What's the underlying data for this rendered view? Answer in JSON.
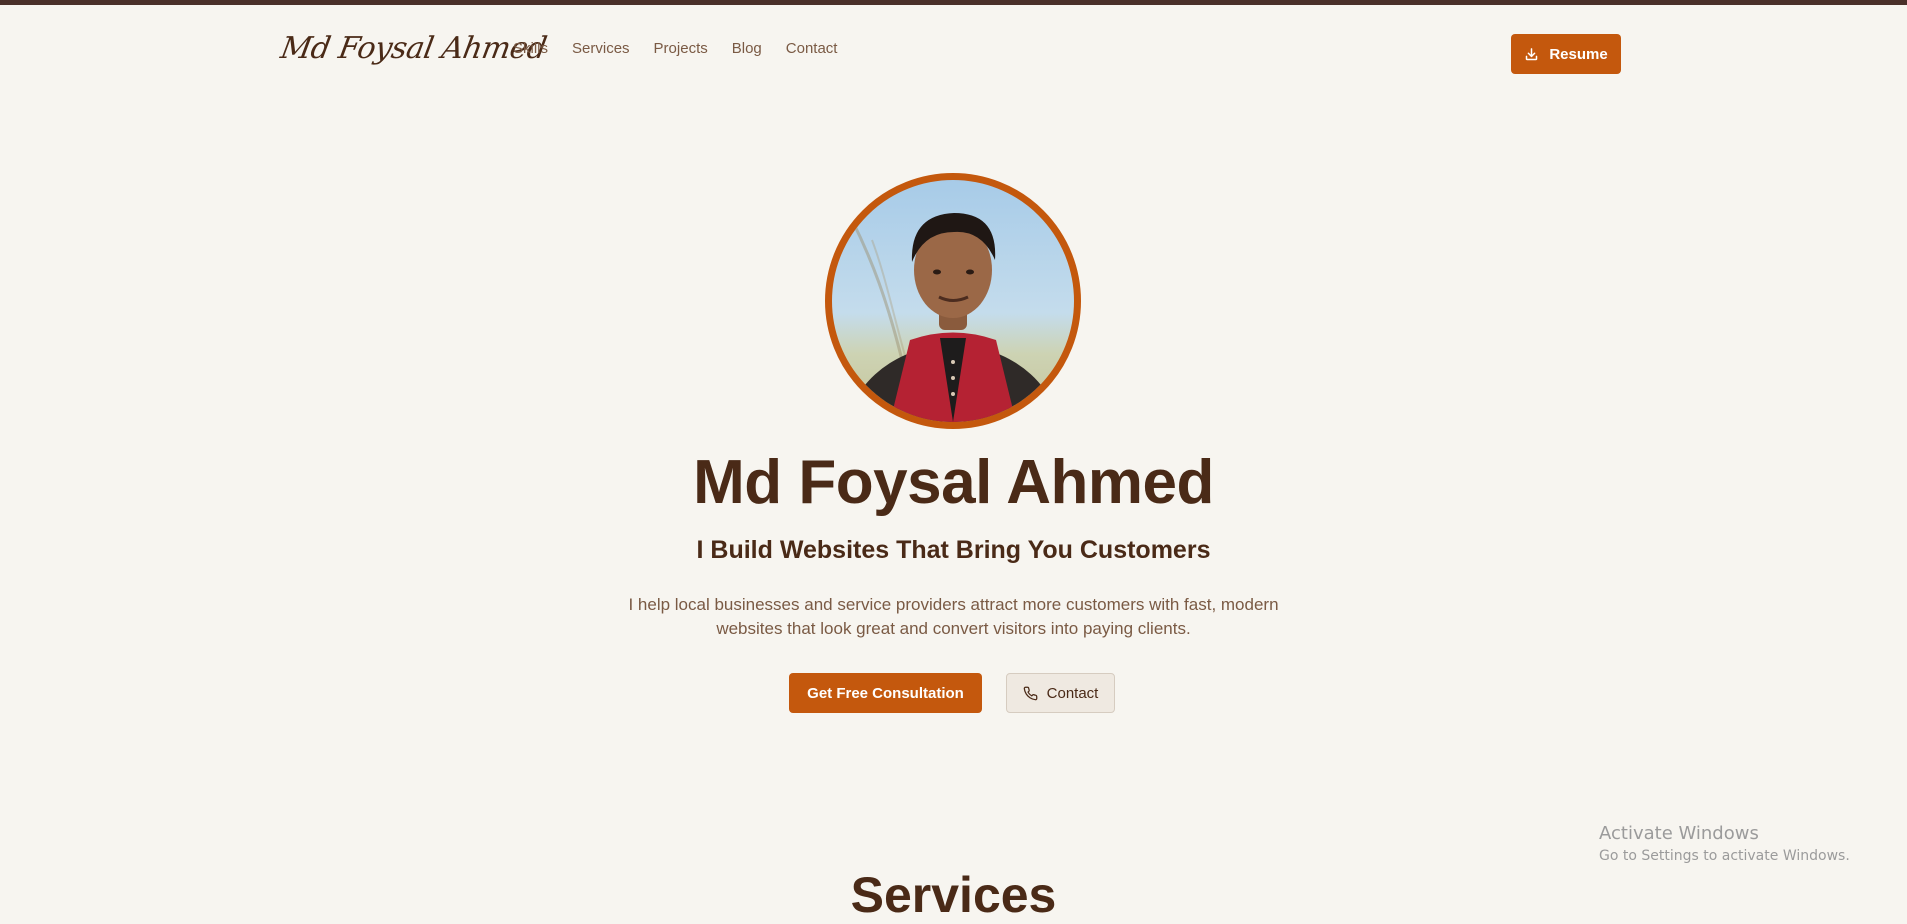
{
  "header": {
    "logo_text": "Md Foysal Ahmed",
    "nav": [
      "Skills",
      "Services",
      "Projects",
      "Blog",
      "Contact"
    ],
    "resume_label": "Resume"
  },
  "hero": {
    "name": "Md Foysal Ahmed",
    "tagline": "I Build Websites That Bring You Customers",
    "description": "I help local businesses and service providers attract more customers with fast, modern websites that look great and convert visitors into paying clients.",
    "primary_cta": "Get Free Consultation",
    "secondary_cta": "Contact"
  },
  "sections": {
    "services_heading": "Services"
  },
  "system_overlay": {
    "title": "Activate Windows",
    "subtitle": "Go to Settings to activate Windows."
  },
  "colors": {
    "accent": "#c4580d",
    "text_dark": "#4a2a17",
    "text_muted": "#7a5a44",
    "background": "#f7f5f0"
  },
  "icons": {
    "resume": "download-icon",
    "contact": "phone-icon"
  }
}
